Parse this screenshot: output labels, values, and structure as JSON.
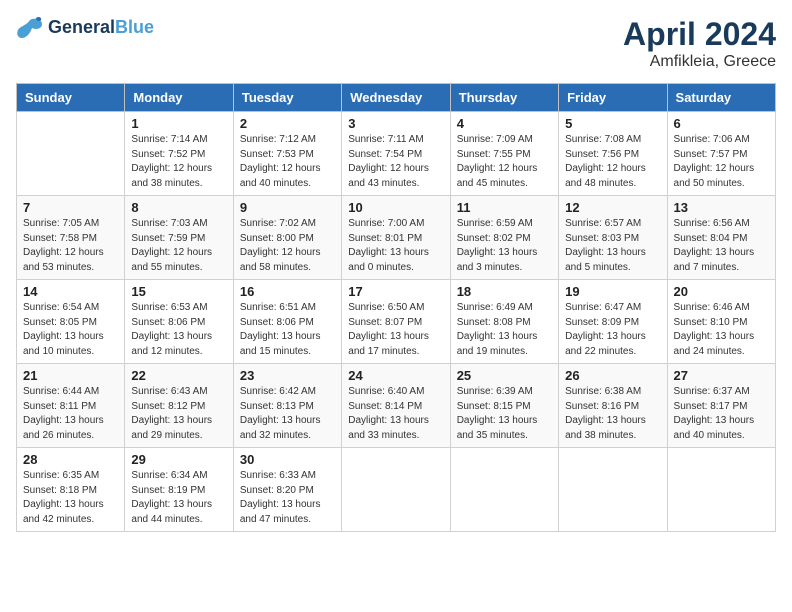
{
  "logo": {
    "line1": "General",
    "line2": "Blue"
  },
  "title": "April 2024",
  "subtitle": "Amfikleia, Greece",
  "days_header": [
    "Sunday",
    "Monday",
    "Tuesday",
    "Wednesday",
    "Thursday",
    "Friday",
    "Saturday"
  ],
  "weeks": [
    [
      {
        "num": "",
        "info": ""
      },
      {
        "num": "1",
        "info": "Sunrise: 7:14 AM\nSunset: 7:52 PM\nDaylight: 12 hours\nand 38 minutes."
      },
      {
        "num": "2",
        "info": "Sunrise: 7:12 AM\nSunset: 7:53 PM\nDaylight: 12 hours\nand 40 minutes."
      },
      {
        "num": "3",
        "info": "Sunrise: 7:11 AM\nSunset: 7:54 PM\nDaylight: 12 hours\nand 43 minutes."
      },
      {
        "num": "4",
        "info": "Sunrise: 7:09 AM\nSunset: 7:55 PM\nDaylight: 12 hours\nand 45 minutes."
      },
      {
        "num": "5",
        "info": "Sunrise: 7:08 AM\nSunset: 7:56 PM\nDaylight: 12 hours\nand 48 minutes."
      },
      {
        "num": "6",
        "info": "Sunrise: 7:06 AM\nSunset: 7:57 PM\nDaylight: 12 hours\nand 50 minutes."
      }
    ],
    [
      {
        "num": "7",
        "info": "Sunrise: 7:05 AM\nSunset: 7:58 PM\nDaylight: 12 hours\nand 53 minutes."
      },
      {
        "num": "8",
        "info": "Sunrise: 7:03 AM\nSunset: 7:59 PM\nDaylight: 12 hours\nand 55 minutes."
      },
      {
        "num": "9",
        "info": "Sunrise: 7:02 AM\nSunset: 8:00 PM\nDaylight: 12 hours\nand 58 minutes."
      },
      {
        "num": "10",
        "info": "Sunrise: 7:00 AM\nSunset: 8:01 PM\nDaylight: 13 hours\nand 0 minutes."
      },
      {
        "num": "11",
        "info": "Sunrise: 6:59 AM\nSunset: 8:02 PM\nDaylight: 13 hours\nand 3 minutes."
      },
      {
        "num": "12",
        "info": "Sunrise: 6:57 AM\nSunset: 8:03 PM\nDaylight: 13 hours\nand 5 minutes."
      },
      {
        "num": "13",
        "info": "Sunrise: 6:56 AM\nSunset: 8:04 PM\nDaylight: 13 hours\nand 7 minutes."
      }
    ],
    [
      {
        "num": "14",
        "info": "Sunrise: 6:54 AM\nSunset: 8:05 PM\nDaylight: 13 hours\nand 10 minutes."
      },
      {
        "num": "15",
        "info": "Sunrise: 6:53 AM\nSunset: 8:06 PM\nDaylight: 13 hours\nand 12 minutes."
      },
      {
        "num": "16",
        "info": "Sunrise: 6:51 AM\nSunset: 8:06 PM\nDaylight: 13 hours\nand 15 minutes."
      },
      {
        "num": "17",
        "info": "Sunrise: 6:50 AM\nSunset: 8:07 PM\nDaylight: 13 hours\nand 17 minutes."
      },
      {
        "num": "18",
        "info": "Sunrise: 6:49 AM\nSunset: 8:08 PM\nDaylight: 13 hours\nand 19 minutes."
      },
      {
        "num": "19",
        "info": "Sunrise: 6:47 AM\nSunset: 8:09 PM\nDaylight: 13 hours\nand 22 minutes."
      },
      {
        "num": "20",
        "info": "Sunrise: 6:46 AM\nSunset: 8:10 PM\nDaylight: 13 hours\nand 24 minutes."
      }
    ],
    [
      {
        "num": "21",
        "info": "Sunrise: 6:44 AM\nSunset: 8:11 PM\nDaylight: 13 hours\nand 26 minutes."
      },
      {
        "num": "22",
        "info": "Sunrise: 6:43 AM\nSunset: 8:12 PM\nDaylight: 13 hours\nand 29 minutes."
      },
      {
        "num": "23",
        "info": "Sunrise: 6:42 AM\nSunset: 8:13 PM\nDaylight: 13 hours\nand 32 minutes."
      },
      {
        "num": "24",
        "info": "Sunrise: 6:40 AM\nSunset: 8:14 PM\nDaylight: 13 hours\nand 33 minutes."
      },
      {
        "num": "25",
        "info": "Sunrise: 6:39 AM\nSunset: 8:15 PM\nDaylight: 13 hours\nand 35 minutes."
      },
      {
        "num": "26",
        "info": "Sunrise: 6:38 AM\nSunset: 8:16 PM\nDaylight: 13 hours\nand 38 minutes."
      },
      {
        "num": "27",
        "info": "Sunrise: 6:37 AM\nSunset: 8:17 PM\nDaylight: 13 hours\nand 40 minutes."
      }
    ],
    [
      {
        "num": "28",
        "info": "Sunrise: 6:35 AM\nSunset: 8:18 PM\nDaylight: 13 hours\nand 42 minutes."
      },
      {
        "num": "29",
        "info": "Sunrise: 6:34 AM\nSunset: 8:19 PM\nDaylight: 13 hours\nand 44 minutes."
      },
      {
        "num": "30",
        "info": "Sunrise: 6:33 AM\nSunset: 8:20 PM\nDaylight: 13 hours\nand 47 minutes."
      },
      {
        "num": "",
        "info": ""
      },
      {
        "num": "",
        "info": ""
      },
      {
        "num": "",
        "info": ""
      },
      {
        "num": "",
        "info": ""
      }
    ]
  ]
}
